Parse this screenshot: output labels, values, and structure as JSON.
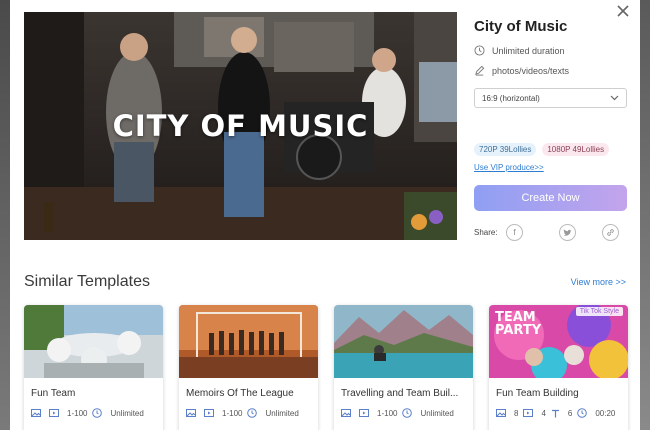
{
  "template": {
    "title": "City of Music",
    "hero_title": "CITY OF MUSIC",
    "duration": "Unlimited duration",
    "media": "photos/videos/texts",
    "ratio": "16:9 (horizontal)",
    "prices": [
      "720P 39Lollies",
      "1080P 49Lollies"
    ],
    "vip_link": "Use VIP produce>>",
    "create_label": "Create Now",
    "share_label": "Share:"
  },
  "similar": {
    "title": "Similar Templates",
    "view_more": "View more >>",
    "cards": [
      {
        "name": "Fun Team",
        "range": "1-100",
        "duration": "Unlimited"
      },
      {
        "name": "Memoirs Of The League",
        "range": "1-100",
        "duration": "Unlimited"
      },
      {
        "name": "Travelling and Team Buil...",
        "range": "1-100",
        "duration": "Unlimited"
      },
      {
        "name": "Fun Team Building",
        "tag": "Tik Tok Style",
        "thumb_text": "TEAM PARTY",
        "photos": "8",
        "videos": "4",
        "texts": "6",
        "duration": "00:20"
      }
    ]
  },
  "icons": [
    "close-icon",
    "clock-icon",
    "edit-icon",
    "chevron-down-icon",
    "facebook-icon",
    "twitter-icon",
    "link-icon",
    "image-icon",
    "video-icon",
    "text-icon"
  ],
  "colors": {
    "accent": "#2e7dd1",
    "create_from": "#8f9ff3",
    "create_to": "#c3a4ec",
    "tag_text": "#9b5fd1"
  }
}
